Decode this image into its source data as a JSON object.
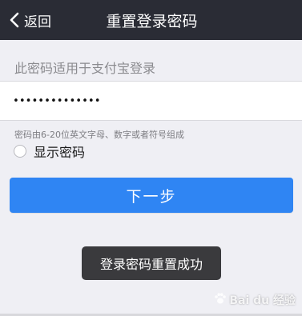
{
  "navbar": {
    "back_label": "返回",
    "title": "重置登录密码"
  },
  "form": {
    "hint": "此密码适用于支付宝登录",
    "password_value": "••••••••••••••",
    "rule": "密码由6-20位英文字母、数字或者符号组成",
    "show_password_label": "显示密码",
    "show_password_checked": false,
    "next_label": "下一步"
  },
  "toast": {
    "message": "登录密码重置成功"
  },
  "watermark": {
    "text": "Bai du 经验"
  },
  "colors": {
    "navbar_bg": "#2a2c35",
    "page_bg": "#efeff4",
    "primary_button": "#2f85f3",
    "toast_bg": "#3a3a3d"
  },
  "icons": {
    "back": "chevron-left-icon",
    "radio": "radio-unchecked-icon",
    "watermark_logo": "paw-icon"
  }
}
